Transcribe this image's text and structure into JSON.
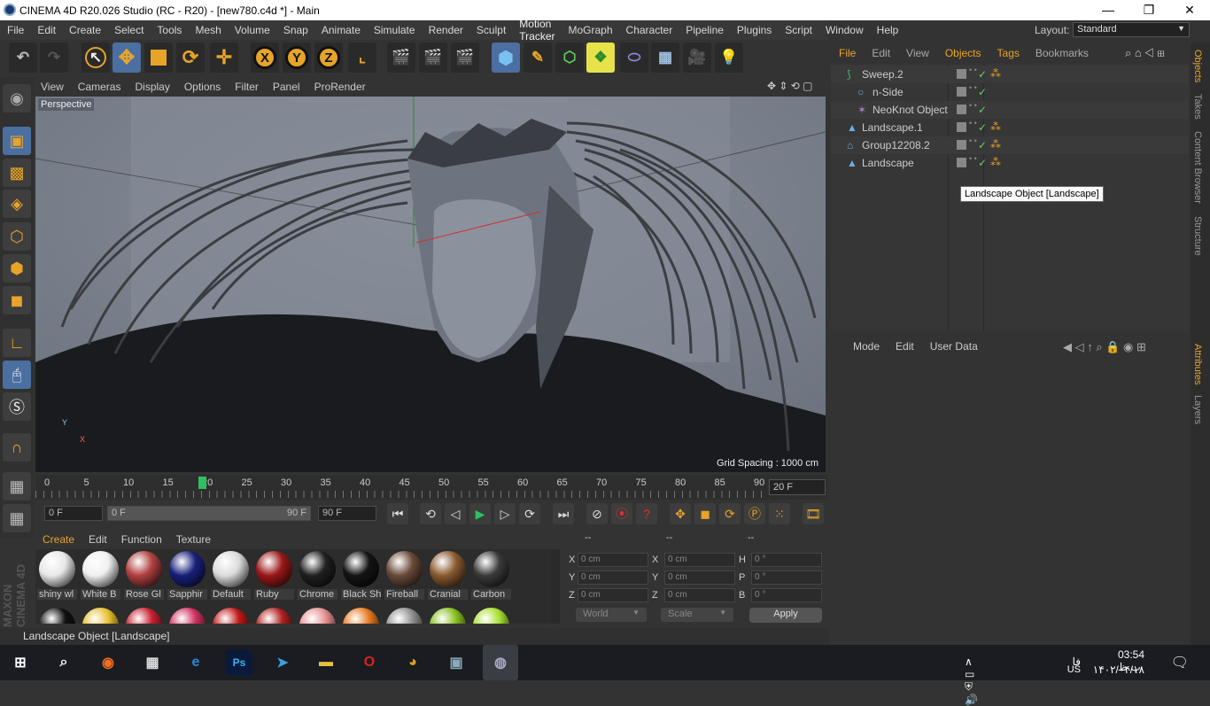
{
  "window": {
    "title": "CINEMA 4D R20.026 Studio (RC - R20) - [new780.c4d *] - Main",
    "minimize": "—",
    "restore": "❐",
    "close": "✕"
  },
  "menu": [
    "File",
    "Edit",
    "Create",
    "Select",
    "Tools",
    "Mesh",
    "Volume",
    "Snap",
    "Animate",
    "Simulate",
    "Render",
    "Sculpt",
    "Motion Tracker",
    "MoGraph",
    "Character",
    "Pipeline",
    "Plugins",
    "Script",
    "Window",
    "Help"
  ],
  "layout": {
    "label": "Layout:",
    "value": "Standard"
  },
  "toolbar": {
    "x": "X",
    "y": "Y",
    "z": "Z"
  },
  "viewport": {
    "menu": [
      "View",
      "Cameras",
      "Display",
      "Options",
      "Filter",
      "Panel",
      "ProRender"
    ],
    "camera_label": "Perspective",
    "grid_spacing": "Grid Spacing : 1000 cm",
    "axis_y": "Y",
    "axis_x": "X"
  },
  "timeline": {
    "ticks": [
      "0",
      "5",
      "10",
      "15",
      "20",
      "25",
      "30",
      "35",
      "40",
      "45",
      "50",
      "55",
      "60",
      "65",
      "70",
      "75",
      "80",
      "85",
      "90"
    ],
    "current_frame": 20,
    "end_field": "20 F"
  },
  "playback": {
    "start": "0 F",
    "range_start": "0 F",
    "range_end": "90 F",
    "end": "90 F"
  },
  "materials": {
    "menu": [
      "Create",
      "Edit",
      "Function",
      "Texture"
    ],
    "items": [
      {
        "name": "shiny wl",
        "color": "#e8e8e8"
      },
      {
        "name": "White B",
        "color": "#f0f0f0"
      },
      {
        "name": "Rose Gl",
        "color": "#b04040"
      },
      {
        "name": "Sapphir",
        "color": "#18207a"
      },
      {
        "name": "Default",
        "color": "#dcdcdc"
      },
      {
        "name": "Ruby",
        "color": "#9a1818"
      },
      {
        "name": "Chrome",
        "color": "#202020"
      },
      {
        "name": "Black Sh",
        "color": "#141414"
      },
      {
        "name": "Fireball",
        "color": "#6a4a3a"
      },
      {
        "name": "Cranial",
        "color": "#8a5a30"
      },
      {
        "name": "Carbon",
        "color": "#3a3a3a"
      }
    ],
    "row2_colors": [
      "#111111",
      "#e8c030",
      "#c82030",
      "#d03060",
      "#c01818",
      "#b02020",
      "#e89090",
      "#e87a20",
      "#909090",
      "#88c020",
      "#a8e030"
    ]
  },
  "coordinates": {
    "headers": [
      "--",
      "--",
      "--"
    ],
    "rows": [
      {
        "a": "X",
        "av": "0 cm",
        "b": "X",
        "bv": "0 cm",
        "c": "H",
        "cv": "0 °"
      },
      {
        "a": "Y",
        "av": "0 cm",
        "b": "Y",
        "bv": "0 cm",
        "c": "P",
        "cv": "0 °"
      },
      {
        "a": "Z",
        "av": "0 cm",
        "b": "Z",
        "bv": "0 cm",
        "c": "B",
        "cv": "0 °"
      }
    ],
    "world": "World",
    "scale": "Scale",
    "apply": "Apply"
  },
  "status": "Landscape Object [Landscape]",
  "objects": {
    "menu": [
      "File",
      "Edit",
      "View",
      "Objects",
      "Tags",
      "Bookmarks"
    ],
    "items": [
      {
        "name": "Sweep.2",
        "icon": "sweep-icon",
        "indent": 0,
        "tags": true
      },
      {
        "name": "n-Side",
        "icon": "circle-icon",
        "indent": 1,
        "tags": false
      },
      {
        "name": "NeoKnot Object",
        "icon": "knot-icon",
        "indent": 1,
        "tags": false
      },
      {
        "name": "Landscape.1",
        "icon": "landscape-icon",
        "indent": 0,
        "tags": true
      },
      {
        "name": "Group12208.2",
        "icon": "null-icon",
        "indent": 0,
        "tags": true
      },
      {
        "name": "Landscape",
        "icon": "landscape-icon",
        "indent": 0,
        "tags": true
      }
    ],
    "tooltip": "Landscape Object [Landscape]"
  },
  "attributes": {
    "menu": [
      "Mode",
      "Edit",
      "User Data"
    ]
  },
  "side_tabs": [
    "Objects",
    "Takes",
    "Content Browser",
    "Structure",
    "Attributes",
    "Layers"
  ],
  "brand": "MAXON CINEMA 4D",
  "taskbar": {
    "time": "03:54 ب.ظ",
    "date": "۱۴۰۲/۰۴/۱۸",
    "lang": "US",
    "lang2": "فا"
  }
}
